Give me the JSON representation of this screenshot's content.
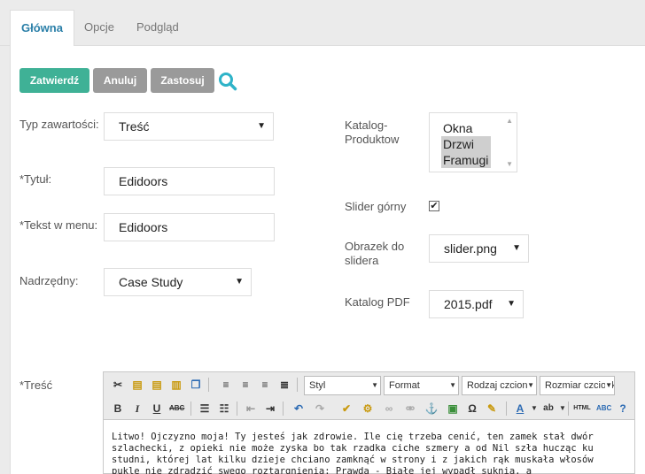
{
  "tabs": [
    {
      "label": "Główna",
      "active": true
    },
    {
      "label": "Opcje",
      "active": false
    },
    {
      "label": "Podgląd",
      "active": false
    }
  ],
  "actions": {
    "approve": "Zatwierdź",
    "cancel": "Anuluj",
    "apply": "Zastosuj"
  },
  "form": {
    "type_label": "Typ zawartości:",
    "type_value": "Treść",
    "title_label": "*Tytuł:",
    "title_value": "Edidoors",
    "menu_label": "*Tekst w menu:",
    "menu_value": "Edidoors",
    "parent_label": "Nadrzędny:",
    "parent_value": "Case Study",
    "catalog_label": "Katalog-Produktow",
    "catalog_options": [
      {
        "label": "Okna",
        "selected": false
      },
      {
        "label": "Drzwi",
        "selected": true
      },
      {
        "label": "Framugi",
        "selected": true
      }
    ],
    "slider_top_label": "Slider górny",
    "slider_top_checked": true,
    "slider_image_label": "Obrazek do slidera",
    "slider_image_value": "slider.png",
    "pdf_label": "Katalog PDF",
    "pdf_value": "2015.pdf",
    "content_label": "*Treść"
  },
  "editor": {
    "combo_style": "Styl",
    "combo_format": "Format",
    "combo_font": "Rodzaj czcionki",
    "combo_size": "Rozmiar czcionki",
    "text": "Litwo! Ojczyzno moja! Ty jesteś jak zdrowie. Ile cię trzeba cenić, ten zamek stał dwór szlachecki, z opieki nie może zyska bo tak rzadka ciche szmery a od Nil szła hucząc ku studni, której lat kilku dzieje chciano zamknąć w strony i z jakich rąk muskała włosów pukle nie zdradzić swego roztargnienia: Prawda - Białe jej wypadł suknia, a"
  },
  "colors": {
    "accent": "#2a7fa8",
    "approve_btn": "#3fb196",
    "neutral_btn": "#9a9a9a",
    "search_icon": "#2eb3c8"
  }
}
